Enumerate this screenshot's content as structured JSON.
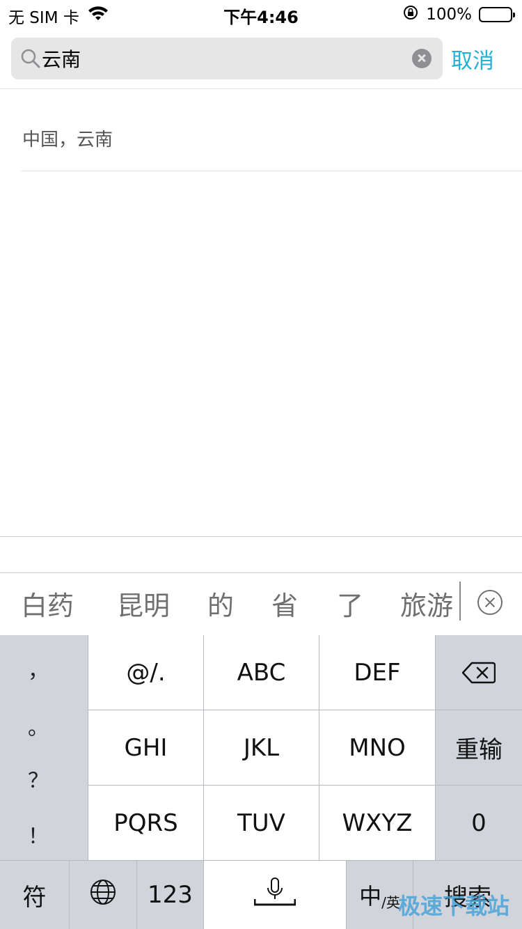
{
  "status_bar": {
    "carrier": "无 SIM 卡",
    "time": "下午4:46",
    "battery": "100%"
  },
  "search": {
    "query": "云南",
    "cancel_label": "取消"
  },
  "results": [
    {
      "label": "中国，云南"
    }
  ],
  "candidates": [
    "白药",
    "昆明",
    "的",
    "省",
    "了",
    "旅游"
  ],
  "keyboard": {
    "punct": [
      "，",
      "。",
      "？",
      "！"
    ],
    "row1": [
      "@/.",
      "ABC",
      "DEF"
    ],
    "row2": [
      "GHI",
      "JKL",
      "MNO"
    ],
    "row3": [
      "PQRS",
      "TUV",
      "WXYZ"
    ],
    "reenter_label": "重输",
    "zero_label": "0",
    "symbols_label": "符",
    "numbers_label": "123",
    "cn_label": "中",
    "en_label": "/英",
    "search_label": "搜索"
  },
  "watermark": "极速下载站"
}
